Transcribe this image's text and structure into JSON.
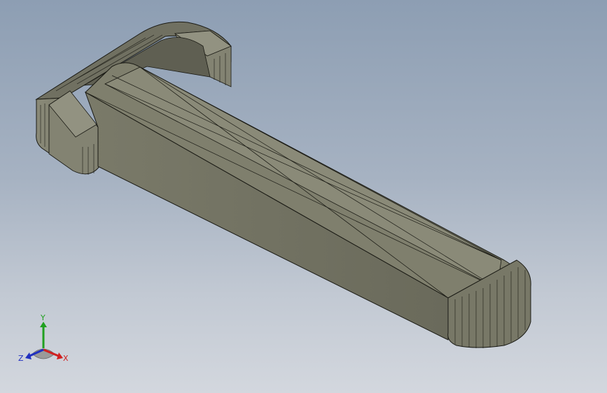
{
  "viewport": {
    "name": "3d-model-viewport",
    "background_top": "#8d9eb3",
    "background_bottom": "#d3d7de"
  },
  "model": {
    "face_color": "#8b8b79",
    "top_face_color": "#7d7d6c",
    "side_face_color": "#6d6d5e",
    "edge_color": "#1a1a14"
  },
  "triad": {
    "x_label": "X",
    "y_label": "Y",
    "z_label": "Z",
    "x_color": "#d02020",
    "y_color": "#20a020",
    "z_color": "#2030c0"
  }
}
